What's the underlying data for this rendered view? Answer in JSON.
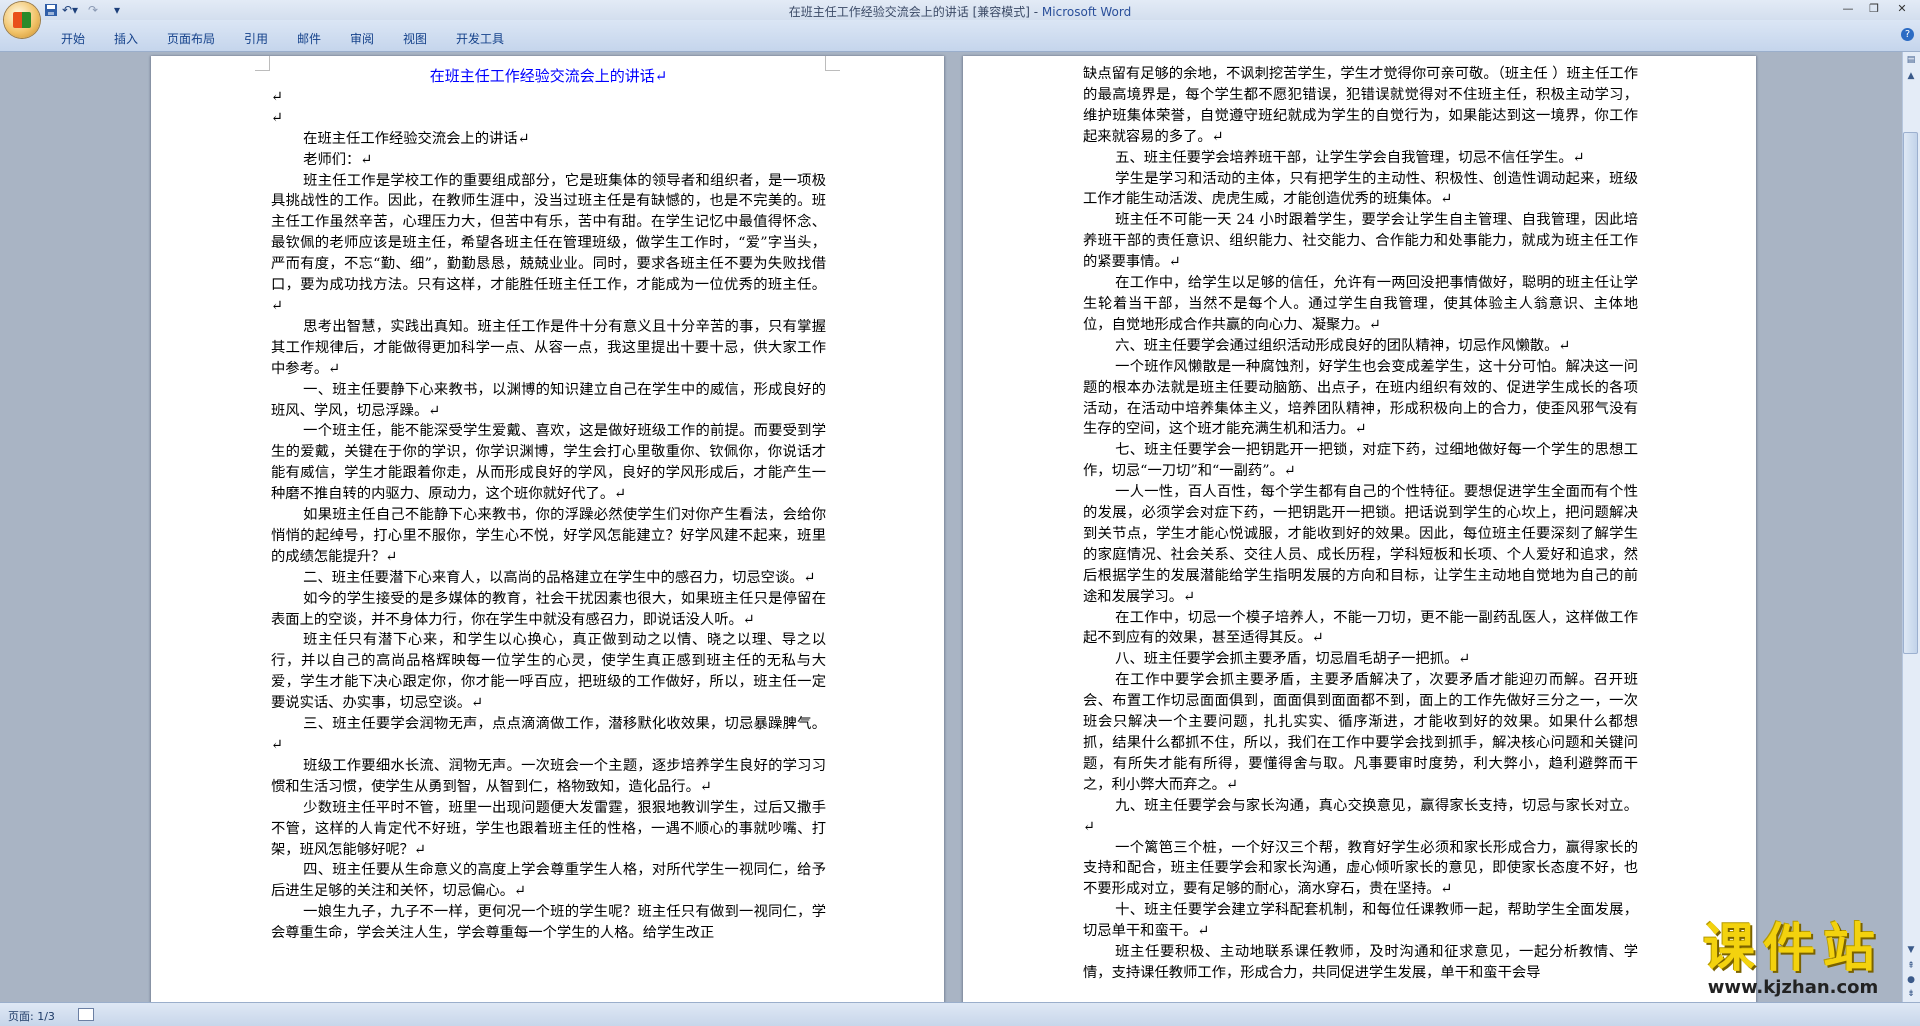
{
  "titlebar": {
    "document_title": "在班主任工作经验交流会上的讲话 [兼容模式] - ",
    "app_name": "Microsoft Word",
    "icons": [
      "office-button-icon",
      "save-icon",
      "undo-icon",
      "redo-icon",
      "customize-qat-icon",
      "minimize-icon",
      "restore-icon",
      "close-icon"
    ]
  },
  "ribbon": {
    "tabs": [
      "开始",
      "插入",
      "页面布局",
      "引用",
      "邮件",
      "审阅",
      "视图",
      "开发工具"
    ]
  },
  "page1": {
    "title": "在班主任工作经验交流会上的讲话↵",
    "paragraphs": [
      {
        "text": "↵",
        "indent": false
      },
      {
        "text": "↵",
        "indent": false
      },
      {
        "text": "在班主任工作经验交流会上的讲话↵",
        "indent": true
      },
      {
        "text": "老师们：↵",
        "indent": true
      },
      {
        "text": "班主任工作是学校工作的重要组成部分，它是班集体的领导者和组织者，是一项极具挑战性的工作。因此，在教师生涯中，没当过班主任是有缺憾的，也是不完美的。班主任工作虽然辛苦，心理压力大，但苦中有乐，苦中有甜。在学生记忆中最值得怀念、最钦佩的老师应该是班主任，希望各班主任在管理班级，做学生工作时，“爱”字当头，严而有度，不忘“勤、细”，勤勤恳恳，兢兢业业。同时，要求各班主任不要为失败找借口，要为成功找方法。只有这样，才能胜任班主任工作，才能成为一位优秀的班主任。↵",
        "indent": true
      },
      {
        "text": "思考出智慧，实践出真知。班主任工作是件十分有意义且十分辛苦的事，只有掌握其工作规律后，才能做得更加科学一点、从容一点，我这里提出十要十忌，供大家工作中参考。↵",
        "indent": true
      },
      {
        "text": "一、班主任要静下心来教书，以渊博的知识建立自己在学生中的威信，形成良好的班风、学风，切忌浮躁。↵",
        "indent": true
      },
      {
        "text": "一个班主任，能不能深受学生爱戴、喜欢，这是做好班级工作的前提。而要受到学生的爱戴，关键在于你的学识，你学识渊博，学生会打心里敬重你、钦佩你，你说话才能有威信，学生才能跟着你走，从而形成良好的学风，良好的学风形成后，才能产生一种磨不推自转的内驱力、原动力，这个班你就好代了。↵",
        "indent": true
      },
      {
        "text": "如果班主任自己不能静下心来教书，你的浮躁必然使学生们对你产生看法，会给你悄悄的起绰号，打心里不服你，学生心不悦，好学风怎能建立？好学风建不起来，班里的成绩怎能提升？↵",
        "indent": true
      },
      {
        "text": "二、班主任要潜下心来育人，以高尚的品格建立在学生中的感召力，切忌空谈。↵",
        "indent": true
      },
      {
        "text": "如今的学生接受的是多媒体的教育，社会干扰因素也很大，如果班主任只是停留在表面上的空谈，并不身体力行，你在学生中就没有感召力，即说话没人听。↵",
        "indent": true
      },
      {
        "text": "班主任只有潜下心来，和学生以心换心，真正做到动之以情、晓之以理、导之以行，并以自己的高尚品格辉映每一位学生的心灵，使学生真正感到班主任的无私与大爱，学生才能下决心跟定你，你才能一呼百应，把班级的工作做好，所以，班主任一定要说实话、办实事，切忌空谈。↵",
        "indent": true
      },
      {
        "text": "三、班主任要学会润物无声，点点滴滴做工作，潜移默化收效果，切忌暴躁脾气。↵",
        "indent": true
      },
      {
        "text": "班级工作要细水长流、润物无声。一次班会一个主题，逐步培养学生良好的学习习惯和生活习惯，使学生从勇到智，从智到仁，格物致知，造化品行。↵",
        "indent": true
      },
      {
        "text": "少数班主任平时不管，班里一出现问题便大发雷霆，狠狠地教训学生，过后又撒手不管，这样的人肯定代不好班，学生也跟着班主任的性格，一遇不顺心的事就吵嘴、打架，班风怎能够好呢？↵",
        "indent": true
      },
      {
        "text": "四、班主任要从生命意义的高度上学会尊重学生人格，对所代学生一视同仁，给予后进生足够的关注和关怀，切忌偏心。↵",
        "indent": true
      },
      {
        "text": "一娘生九子，九子不一样，更何况一个班的学生呢？班主任只有做到一视同仁，学会尊重生命，学会关注人生，学会尊重每一个学生的人格。给学生改正",
        "indent": true
      }
    ]
  },
  "page2": {
    "paragraphs": [
      {
        "text": "缺点留有足够的余地，不讽刺挖苦学生，学生才觉得你可亲可敬。（班主任 ）班主任工作的最高境界是，每个学生都不愿犯错误，犯错误就觉得对不住班主任，积极主动学习，维护班集体荣誉，自觉遵守班纪就成为学生的自觉行为，如果能达到这一境界，你工作起来就容易的多了。↵",
        "indent": false
      },
      {
        "text": "五、班主任要学会培养班干部，让学生学会自我管理，切忌不信任学生。↵",
        "indent": true
      },
      {
        "text": "学生是学习和活动的主体，只有把学生的主动性、积极性、创造性调动起来，班级工作才能生动活泼、虎虎生威，才能创造优秀的班集体。↵",
        "indent": true
      },
      {
        "text": "班主任不可能一天 24 小时跟着学生，要学会让学生自主管理、自我管理，因此培养班干部的责任意识、组织能力、社交能力、合作能力和处事能力，就成为班主任工作的紧要事情。↵",
        "indent": true
      },
      {
        "text": "在工作中，给学生以足够的信任，允许有一两回没把事情做好，聪明的班主任让学生轮着当干部，当然不是每个人。通过学生自我管理，使其体验主人翁意识、主体地位，自觉地形成合作共赢的向心力、凝聚力。↵",
        "indent": true
      },
      {
        "text": "六、班主任要学会通过组织活动形成良好的团队精神，切忌作风懒散。↵",
        "indent": true
      },
      {
        "text": "一个班作风懒散是一种腐蚀剂，好学生也会变成差学生，这十分可怕。解决这一问题的根本办法就是班主任要动脑筋、出点子，在班内组织有效的、促进学生成长的各项活动，在活动中培养集体主义，培养团队精神，形成积极向上的合力，使歪风邪气没有生存的空间，这个班才能充满生机和活力。↵",
        "indent": true
      },
      {
        "text": "七、班主任要学会一把钥匙开一把锁，对症下药，过细地做好每一个学生的思想工作，切忌“一刀切”和“一副药”。↵",
        "indent": true
      },
      {
        "text": "一人一性，百人百性，每个学生都有自己的个性特征。要想促进学生全面而有个性的发展，必须学会对症下药，一把钥匙开一把锁。把话说到学生的心坎上，把问题解决到关节点，学生才能心悦诚服，才能收到好的效果。因此，每位班主任要深刻了解学生的家庭情况、社会关系、交往人员、成长历程，学科短板和长项、个人爱好和追求，然后根据学生的发展潜能给学生指明发展的方向和目标，让学生主动地自觉地为自己的前途和发展学习。↵",
        "indent": true
      },
      {
        "text": "在工作中，切忌一个模子培养人，不能一刀切，更不能一副药乱医人，这样做工作起不到应有的效果，甚至适得其反。↵",
        "indent": true
      },
      {
        "text": "八、班主任要学会抓主要矛盾，切忌眉毛胡子一把抓。↵",
        "indent": true
      },
      {
        "text": "在工作中要学会抓主要矛盾，主要矛盾解决了，次要矛盾才能迎刃而解。召开班会、布置工作切忌面面俱到，面面俱到面面都不到，面上的工作先做好三分之一，一次班会只解决一个主要问题，扎扎实实、循序渐进，才能收到好的效果。如果什么都想抓，结果什么都抓不住，所以，我们在工作中要学会找到抓手，解决核心问题和关键问题，有所失才能有所得，要懂得舍与取。凡事要审时度势，利大弊小，趋利避弊而干之，利小弊大而弃之。↵",
        "indent": true
      },
      {
        "text": "九、班主任要学会与家长沟通，真心交换意见，赢得家长支持，切忌与家长对立。↵",
        "indent": true
      },
      {
        "text": "一个篱笆三个桩，一个好汉三个帮，教育好学生必须和家长形成合力，赢得家长的支持和配合，班主任要学会和家长沟通，虚心倾听家长的意见，即使家长态度不好，也不要形成对立，要有足够的耐心，滴水穿石，贵在坚持。↵",
        "indent": true
      },
      {
        "text": "十、班主任要学会建立学科配套机制，和每位任课教师一起，帮助学生全面发展，切忌单干和蛮干。↵",
        "indent": true
      },
      {
        "text": "班主任要积极、主动地联系课任教师，及时沟通和征求意见，一起分析教情、学情，支持课任教师工作，形成合力，共同促进学生发展，单干和蛮干会导",
        "indent": true
      }
    ]
  },
  "statusbar": {
    "page_info": "页面: 1/3"
  },
  "watermark": {
    "logo_text": "课件站",
    "url": "www.kjzhan.com",
    "color": "#f3d20e"
  }
}
